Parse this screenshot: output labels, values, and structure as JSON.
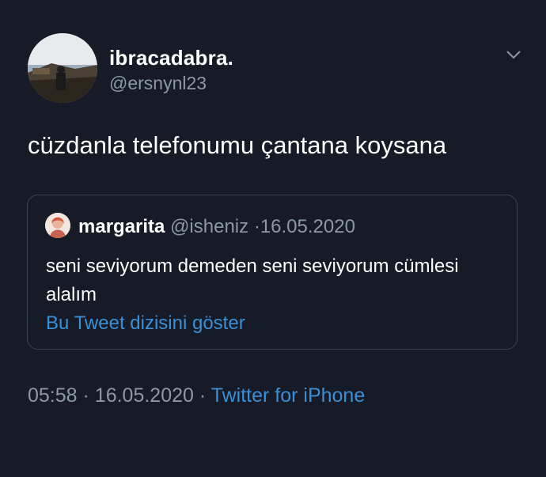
{
  "author": {
    "name": "ibracadabra.",
    "handle": "@ersnynl23"
  },
  "tweet": {
    "text": "cüzdanla telefonumu çantana koysana"
  },
  "quoted_tweet": {
    "name": "margarita",
    "handle": "@isheniz",
    "date": "16.05.2020",
    "text": "seni seviyorum demeden seni seviyorum cümlesi alalım",
    "show_thread_link": "Bu Tweet dizisini göster"
  },
  "meta": {
    "time": "05:58",
    "date": "16.05.2020",
    "source": "Twitter for iPhone"
  },
  "icons": {
    "menu": "chevron-down-icon"
  },
  "colors": {
    "background": "#161b27",
    "secondary_text": "#8b98a5",
    "link": "#3a8fd6",
    "border": "#38444d"
  }
}
